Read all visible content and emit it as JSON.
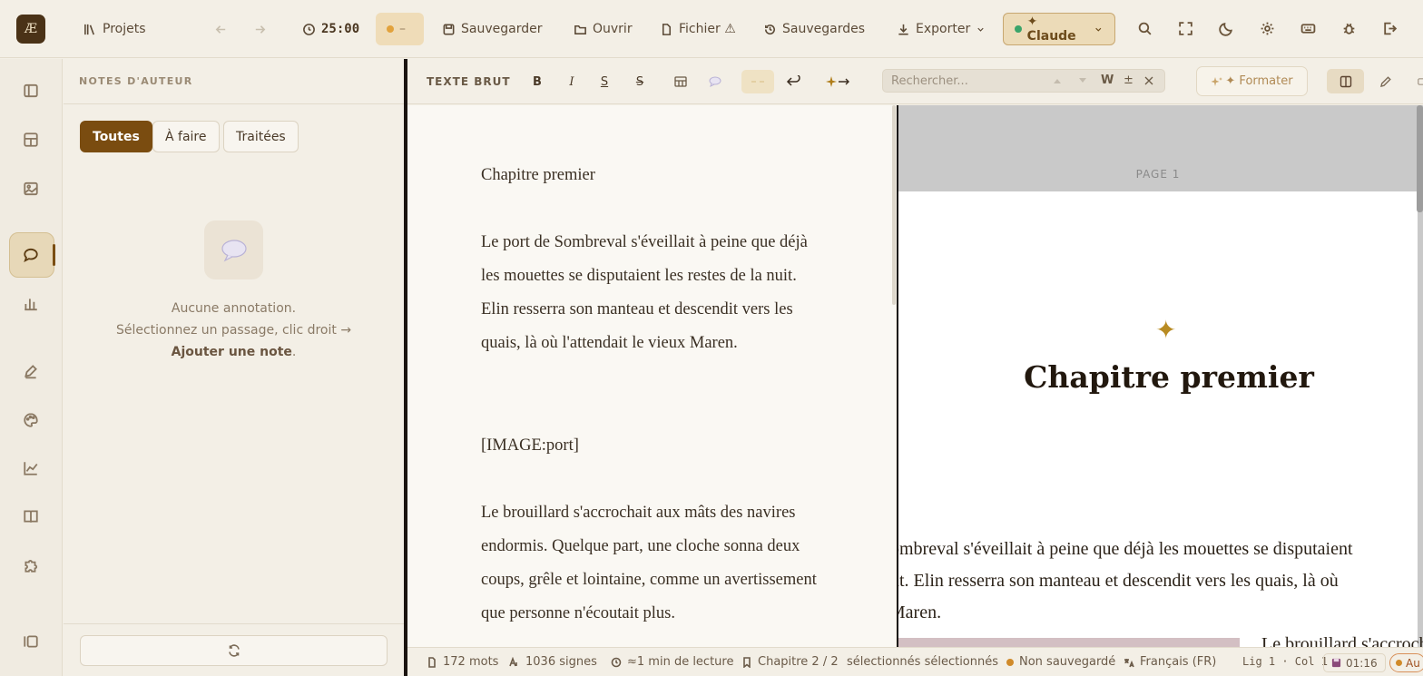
{
  "topbar": {
    "logo": "Æ",
    "projects": "Projets",
    "timer": "25:00",
    "status_pill": "–",
    "save": "Sauvegarder",
    "open": "Ouvrir",
    "file": "Fichier ⚠",
    "backups": "Sauvegardes",
    "export": "Exporter",
    "ai": "✦ Claude"
  },
  "notes": {
    "title": "NOTES D'AUTEUR",
    "filters": [
      "Toutes",
      "À faire",
      "Traitées"
    ],
    "empty_line1": "Aucune annotation.",
    "empty_line2": "Sélectionnez un passage, clic droit →",
    "empty_action": "Ajouter une note",
    "empty_end": "."
  },
  "toolbar": {
    "mode": "TEXTE BRUT",
    "bold": "B",
    "italic": "I",
    "underline": "S",
    "strike": "S",
    "search_placeholder": "Rechercher...",
    "whole_word": "W",
    "case": "±",
    "format": "✦ Formater"
  },
  "editor": {
    "paragraphs": [
      "Chapitre premier",
      "Le port de Sombreval s'éveillait à peine que déjà les mouettes se disputaient les restes de la nuit. Elin resserra son manteau et descendit vers les quais, là où l'attendait le vieux Maren.",
      "[IMAGE:port]",
      "Le brouillard s'accrochait aux mâts des navires endormis. Quelque part, une cloche sonna deux coups, grêle et lointaine, comme un avertissement que personne n'écoutait plus."
    ]
  },
  "preview": {
    "page_label": "PAGE 1",
    "ornament": "✦",
    "chapter_title": "Chapitre premier",
    "lines": [
      "de Sombreval s'éveillait à peine que déjà les mouettes se disputaient",
      "la nuit. Elin resserra son manteau et descendit vers les quais, là où",
      "eux Maren."
    ],
    "side_text": "Le brouillard s'accrochait"
  },
  "status": {
    "words": "172 mots",
    "chars": "1036 signes",
    "reading": "≈1 min de lecture",
    "chapter": "Chapitre 2 / 2",
    "selected": "sélectionnés sélectionnés",
    "save_state": "Non sauvegardé",
    "language": "Français (FR)",
    "cursor": "Lig 1 · Col 1",
    "time": "01:16",
    "auto": "Au"
  },
  "colors": {
    "accent": "#7a4c10",
    "unsaved_dot": "#d08a2a",
    "ai_dot": "#3aa46a",
    "ornament": "#b88b22"
  }
}
